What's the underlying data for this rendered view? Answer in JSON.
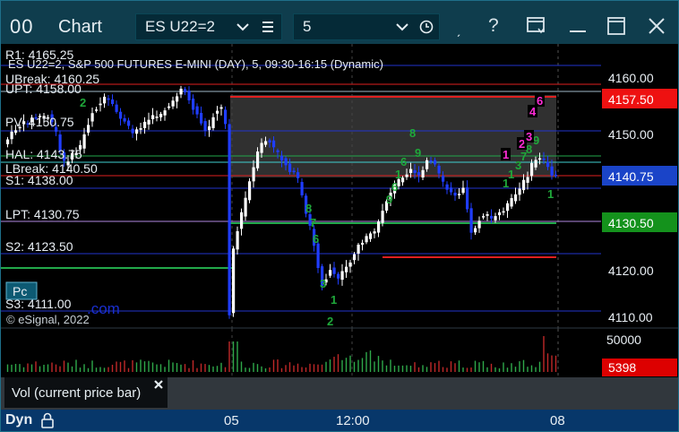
{
  "title": "Chart",
  "symbol_field": "ES U22=2",
  "interval_field": "5",
  "chart_header": "ES U22=2, S&P 500 FUTURES E-MINI (DAY), 5, 09:30-16:15 (Dynamic)",
  "copyright": "© eSignal, 2022",
  "watermark": ".com",
  "pc_button": "Pc",
  "left_labels": {
    "r1": "R1: 4165.25",
    "ubreak": "UBreak: 4160.25",
    "upt": "UPT: 4158.00",
    "pivot": "PV: 4150.75",
    "hal": "HAL: 4143.75",
    "lbreak": "LBreak: 4140.50",
    "s1": "S1: 4138.00",
    "lpt": "LPT: 4130.75",
    "s2": "S2: 4123.50",
    "s3": "S3: 4111.00"
  },
  "price_axis": {
    "ticks": [
      "4160.00",
      "4150.00",
      "4120.00",
      "4110.00"
    ],
    "badge_red": "4157.50",
    "badge_blue": "4140.75",
    "badge_green": "4130.50"
  },
  "volume": {
    "tick": "50000",
    "badge": "5398",
    "tab_label": "Vol (current price bar)"
  },
  "time_axis": {
    "mode": "Dyn",
    "labels": [
      "05",
      "12:00",
      "08"
    ]
  },
  "counters_green": [
    "2",
    "8",
    "9",
    "6",
    "1",
    "6",
    "9",
    "8",
    "7",
    "6",
    "3",
    "1",
    "2",
    "1",
    "1",
    "3",
    "7",
    "8",
    "9",
    "1"
  ],
  "counters_magenta": [
    "1",
    "2",
    "3",
    "4",
    "6"
  ],
  "colors": {
    "background": "#000000",
    "titlebar": "#0f3d4d",
    "axis_bar": "#07376a",
    "bull": "#ffffff",
    "bear": "#1f3dff",
    "red_line": "#e02020",
    "green_line": "#22a84a",
    "blue_line": "#2233cc"
  }
}
